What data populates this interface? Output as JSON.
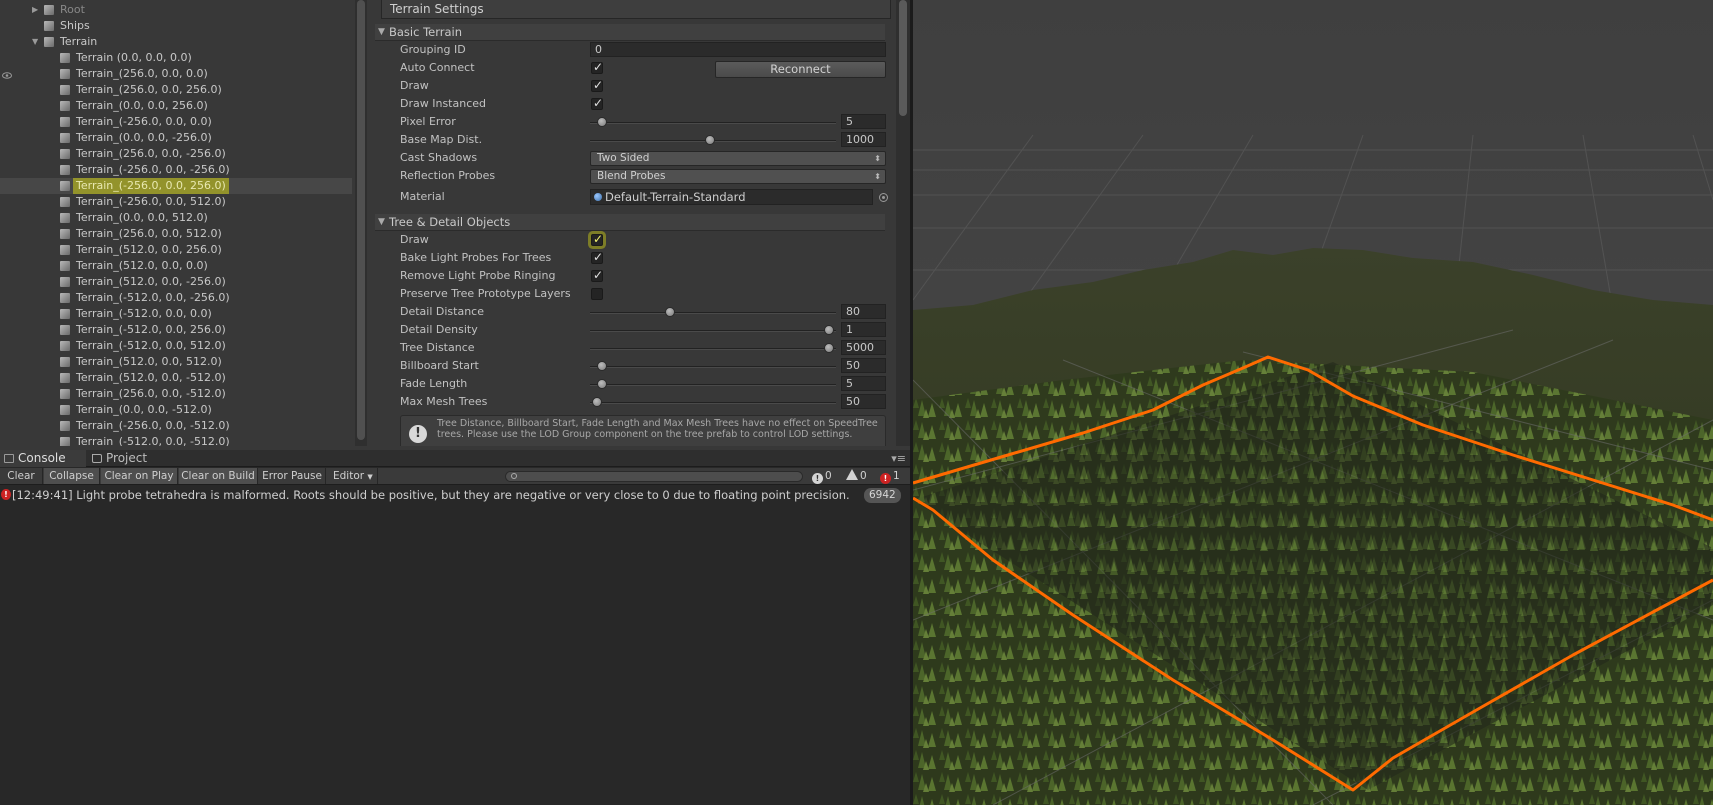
{
  "hierarchy": {
    "items": [
      {
        "label": "Root",
        "depth": 1,
        "expandable": true,
        "expanded": false,
        "dim": true
      },
      {
        "label": "Ships",
        "depth": 1,
        "expandable": false
      },
      {
        "label": "Terrain",
        "depth": 1,
        "expandable": true,
        "expanded": true
      },
      {
        "label": "Terrain (0.0, 0.0, 0.0)",
        "depth": 2
      },
      {
        "label": "Terrain_(256.0, 0.0, 0.0)",
        "depth": 2
      },
      {
        "label": "Terrain_(256.0, 0.0, 256.0)",
        "depth": 2
      },
      {
        "label": "Terrain_(0.0, 0.0, 256.0)",
        "depth": 2
      },
      {
        "label": "Terrain_(-256.0, 0.0, 0.0)",
        "depth": 2
      },
      {
        "label": "Terrain_(0.0, 0.0, -256.0)",
        "depth": 2
      },
      {
        "label": "Terrain_(256.0, 0.0, -256.0)",
        "depth": 2
      },
      {
        "label": "Terrain_(-256.0, 0.0, -256.0)",
        "depth": 2
      },
      {
        "label": "Terrain_(-256.0, 0.0, 256.0)",
        "depth": 2,
        "selected": true
      },
      {
        "label": "Terrain_(-256.0, 0.0, 512.0)",
        "depth": 2
      },
      {
        "label": "Terrain_(0.0, 0.0, 512.0)",
        "depth": 2
      },
      {
        "label": "Terrain_(256.0, 0.0, 512.0)",
        "depth": 2
      },
      {
        "label": "Terrain_(512.0, 0.0, 256.0)",
        "depth": 2
      },
      {
        "label": "Terrain_(512.0, 0.0, 0.0)",
        "depth": 2
      },
      {
        "label": "Terrain_(512.0, 0.0, -256.0)",
        "depth": 2
      },
      {
        "label": "Terrain_(-512.0, 0.0, -256.0)",
        "depth": 2
      },
      {
        "label": "Terrain_(-512.0, 0.0, 0.0)",
        "depth": 2
      },
      {
        "label": "Terrain_(-512.0, 0.0, 256.0)",
        "depth": 2
      },
      {
        "label": "Terrain_(-512.0, 0.0, 512.0)",
        "depth": 2
      },
      {
        "label": "Terrain_(512.0, 0.0, 512.0)",
        "depth": 2
      },
      {
        "label": "Terrain_(512.0, 0.0, -512.0)",
        "depth": 2
      },
      {
        "label": "Terrain_(256.0, 0.0, -512.0)",
        "depth": 2
      },
      {
        "label": "Terrain_(0.0, 0.0, -512.0)",
        "depth": 2
      },
      {
        "label": "Terrain_(-256.0, 0.0, -512.0)",
        "depth": 2
      },
      {
        "label": "Terrain_(-512.0, 0.0, -512.0)",
        "depth": 2
      }
    ]
  },
  "inspector": {
    "title": "Terrain Settings",
    "basic": {
      "header": "Basic Terrain",
      "grouping_id_label": "Grouping ID",
      "grouping_id_value": "0",
      "auto_connect_label": "Auto Connect",
      "auto_connect_checked": true,
      "reconnect_label": "Reconnect",
      "draw_label": "Draw",
      "draw_checked": true,
      "draw_instanced_label": "Draw Instanced",
      "draw_instanced_checked": true,
      "pixel_error_label": "Pixel Error",
      "pixel_error_value": "5",
      "pixel_error_fraction": 0.03,
      "base_map_label": "Base Map Dist.",
      "base_map_value": "1000",
      "base_map_fraction": 0.49,
      "cast_shadows_label": "Cast Shadows",
      "cast_shadows_value": "Two Sided",
      "reflection_label": "Reflection Probes",
      "reflection_value": "Blend Probes",
      "material_label": "Material",
      "material_value": "Default-Terrain-Standard"
    },
    "tree": {
      "header": "Tree & Detail Objects",
      "draw_label": "Draw",
      "draw_checked": true,
      "bake_label": "Bake Light Probes For Trees",
      "bake_checked": true,
      "ringing_label": "Remove Light Probe Ringing",
      "ringing_checked": true,
      "preserve_label": "Preserve Tree Prototype Layers",
      "preserve_checked": false,
      "detail_distance_label": "Detail Distance",
      "detail_distance_value": "80",
      "detail_distance_fraction": 0.32,
      "detail_density_label": "Detail Density",
      "detail_density_value": "1",
      "detail_density_fraction": 1.0,
      "tree_distance_label": "Tree Distance",
      "tree_distance_value": "5000",
      "tree_distance_fraction": 1.0,
      "billboard_label": "Billboard Start",
      "billboard_value": "50",
      "billboard_fraction": 0.03,
      "fade_label": "Fade Length",
      "fade_value": "5",
      "fade_fraction": 0.03,
      "max_mesh_label": "Max Mesh Trees",
      "max_mesh_value": "50",
      "max_mesh_fraction": 0.01,
      "help_text": "Tree Distance, Billboard Start, Fade Length and Max Mesh Trees have no effect on SpeedTree trees. Please use the LOD Group component on the tree prefab to control LOD settings."
    }
  },
  "console": {
    "tabs": [
      "Console",
      "Project"
    ],
    "toolbar": {
      "clear": "Clear",
      "collapse": "Collapse",
      "clear_on_play": "Clear on Play",
      "clear_on_build": "Clear on Build",
      "error_pause": "Error Pause",
      "editor": "Editor"
    },
    "search_placeholder": "",
    "counts": {
      "info": "0",
      "warn": "0",
      "error": "1"
    },
    "log": {
      "message": "[12:49:41] Light probe tetrahedra is malformed. Roots should be positive, but they are negative or very close to 0 due to floating point precision.",
      "count": "6942"
    }
  },
  "colors": {
    "selection_highlight": "#d2d214",
    "terrain_outline": "#ff6a00",
    "error_red": "#cc2222",
    "grid_line": "#6a6a6a",
    "terrain_dark": "#2f3520"
  }
}
